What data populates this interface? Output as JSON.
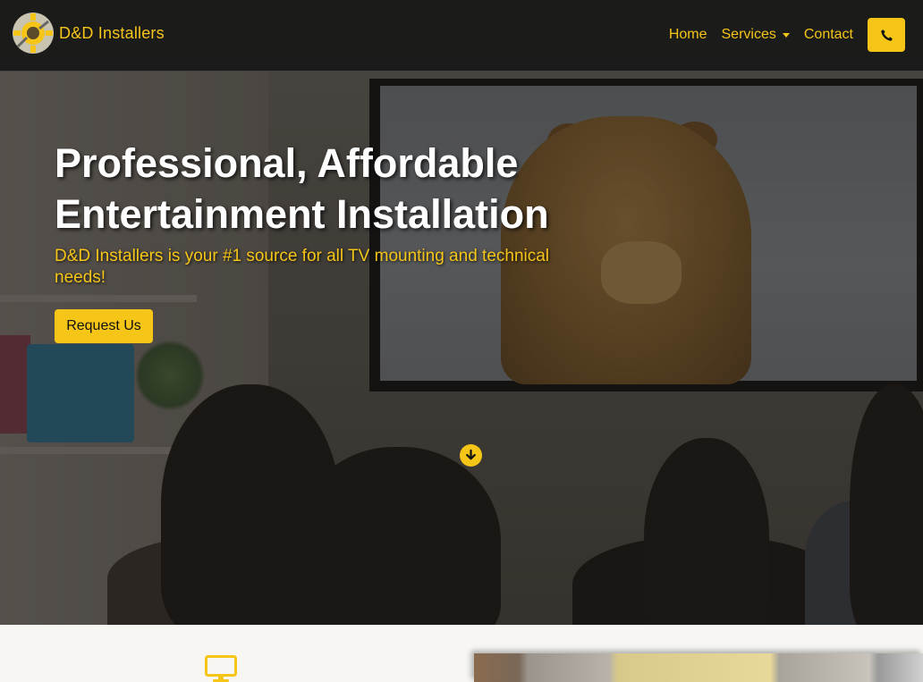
{
  "brand": {
    "name": "D&D Installers",
    "logo_icon": "gear-logo-icon"
  },
  "nav": {
    "home": "Home",
    "services": "Services",
    "contact": "Contact",
    "phone_icon": "phone-icon"
  },
  "hero": {
    "title": "Professional, Affordable Entertainment Installation",
    "subtitle": "D&D Installers is your #1 source for all TV mounting and technical needs!",
    "cta": "Request Us",
    "scroll_icon": "arrow-down-circle-icon"
  },
  "section": {
    "icon": "monitor-icon"
  },
  "colors": {
    "accent": "#f5c518",
    "navbar": "#181818",
    "cta_text": "#111111"
  }
}
